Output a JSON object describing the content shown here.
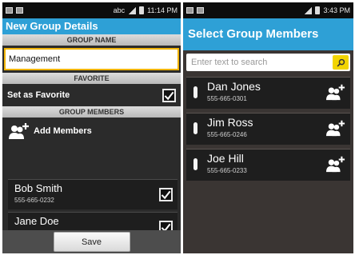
{
  "left": {
    "status": {
      "carrier": "abc",
      "time": "11:14 PM"
    },
    "title": "New Group Details",
    "group_name": {
      "header": "GROUP NAME",
      "value": "Management"
    },
    "favorite": {
      "header": "FAVORITE",
      "label": "Set as Favorite",
      "checked": true
    },
    "members": {
      "header": "GROUP MEMBERS",
      "add_label": "Add Members",
      "items": [
        {
          "name": "Bob Smith",
          "phone": "555-665-0232",
          "checked": true
        },
        {
          "name": "Jane Doe",
          "phone": "",
          "checked": true
        }
      ]
    },
    "save_label": "Save"
  },
  "right": {
    "status": {
      "time": "3:43 PM"
    },
    "title": "Select Group Members",
    "search": {
      "placeholder": "Enter text to search"
    },
    "contacts": [
      {
        "name": "Dan Jones",
        "phone": "555-665-0301"
      },
      {
        "name": "Jim Ross",
        "phone": "555-665-0246"
      },
      {
        "name": "Joe Hill",
        "phone": "555-665-0233"
      }
    ]
  },
  "colors": {
    "accent": "#2ea0d6",
    "highlight": "#f0b400",
    "search_button": "#f2d400"
  },
  "icons": [
    "notification-icon",
    "signal-icon",
    "battery-icon",
    "checkmark-icon",
    "add-member-icon",
    "search-icon",
    "drag-handle-icon"
  ]
}
